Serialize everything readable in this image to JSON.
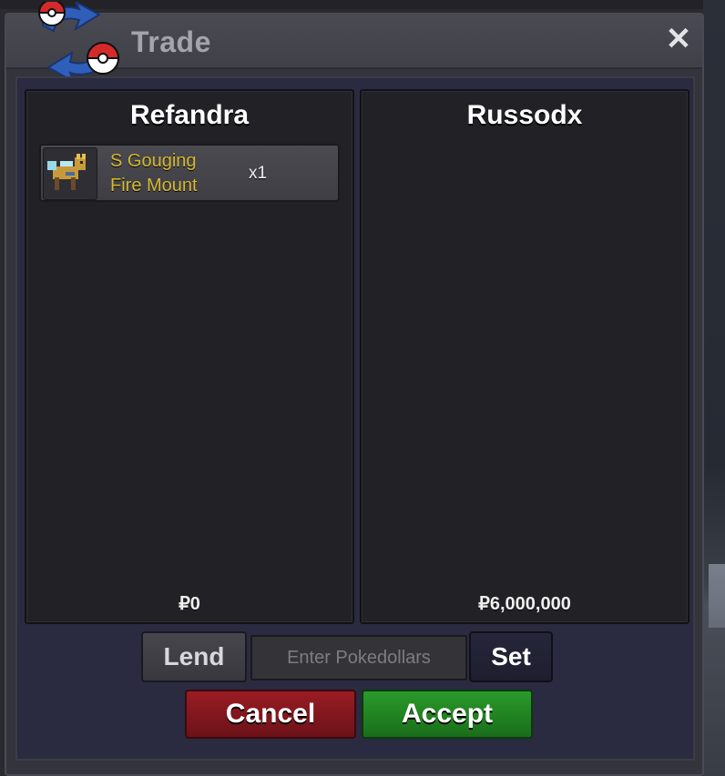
{
  "window": {
    "title": "Trade",
    "close_symbol": "✕"
  },
  "left_player": {
    "name": "Refandra",
    "money": "₽0",
    "items": [
      {
        "name_line1": "S Gouging",
        "name_line2": "Fire Mount",
        "quantity": "x1",
        "icon": "gouging-fire-mount-icon"
      }
    ]
  },
  "right_player": {
    "name": "Russodx",
    "money": "₽6,000,000",
    "items": []
  },
  "controls": {
    "lend_label": "Lend",
    "input_placeholder": "Enter Pokedollars",
    "set_label": "Set",
    "cancel_label": "Cancel",
    "accept_label": "Accept"
  },
  "colors": {
    "item_name": "#d6b830",
    "cancel": "#9a1c24",
    "accept": "#2a9a2a"
  }
}
